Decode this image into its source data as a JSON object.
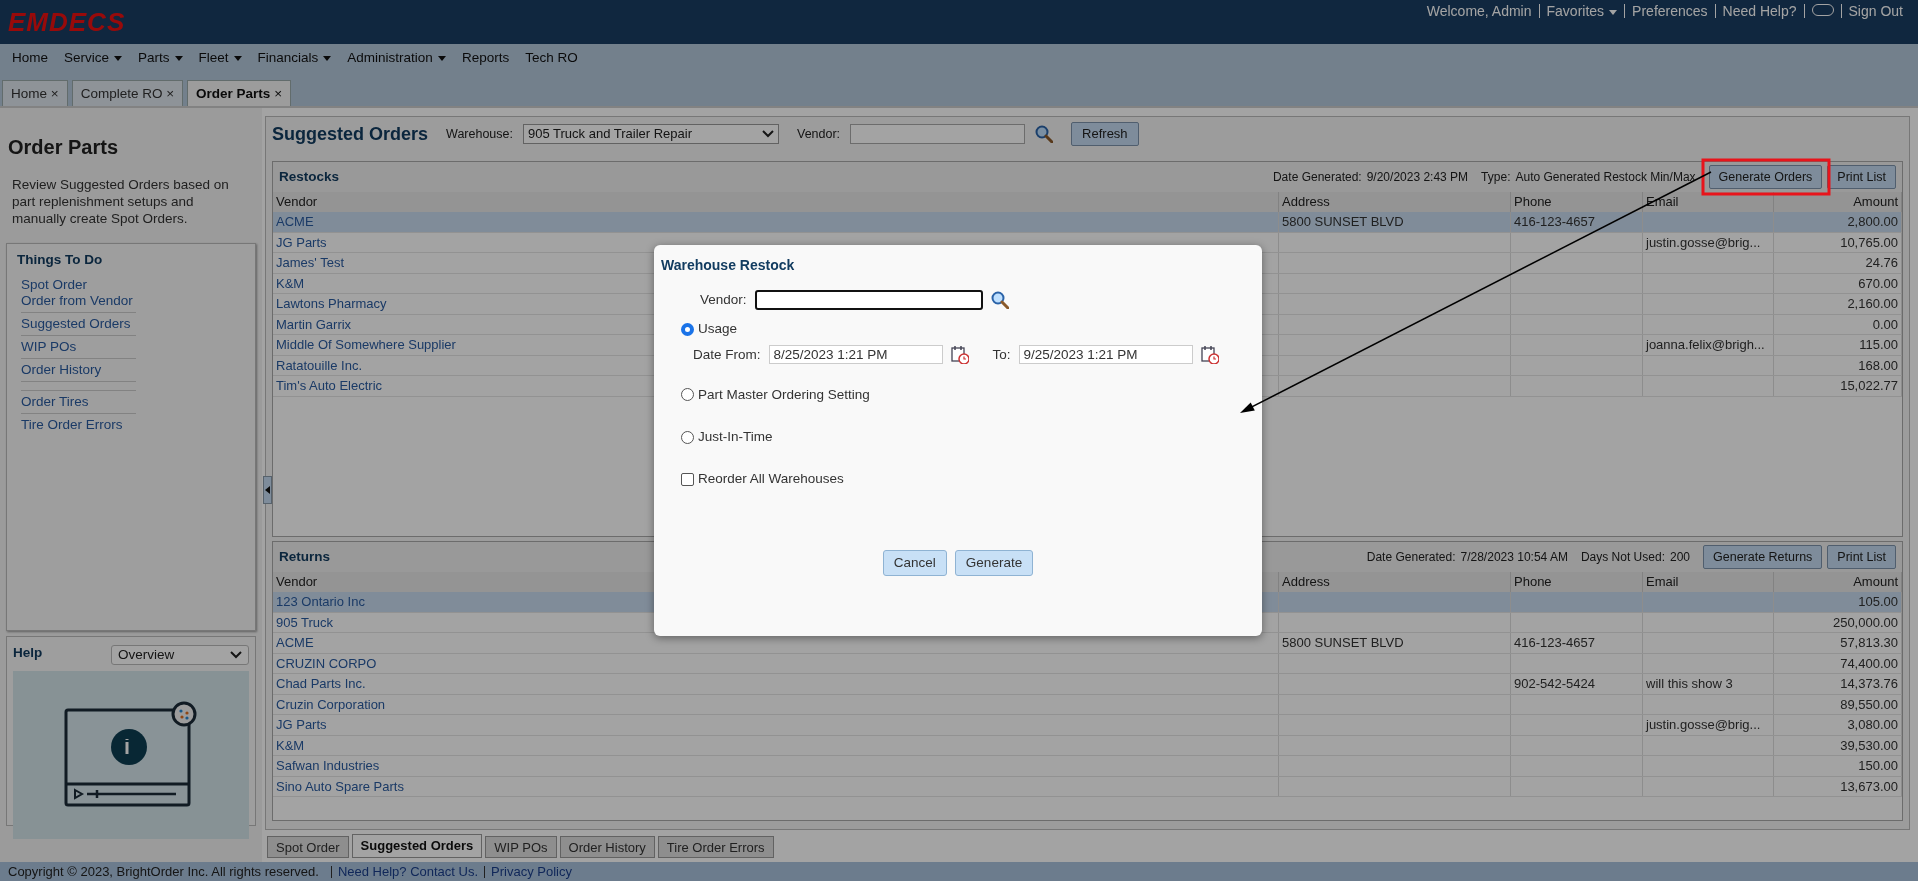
{
  "top_bar": {
    "logo": "EMDECS",
    "links": [
      {
        "label": "Welcome, Admin",
        "kind": "text"
      },
      {
        "label": "Favorites",
        "kind": "dropdown"
      },
      {
        "label": "Preferences",
        "kind": "link"
      },
      {
        "label": "Need Help?",
        "kind": "link"
      },
      {
        "kind": "toggle"
      },
      {
        "label": "Sign Out",
        "kind": "link"
      }
    ]
  },
  "menu": [
    {
      "label": "Home",
      "dropdown": false
    },
    {
      "label": "Service",
      "dropdown": true
    },
    {
      "label": "Parts",
      "dropdown": true
    },
    {
      "label": "Fleet",
      "dropdown": true
    },
    {
      "label": "Financials",
      "dropdown": true
    },
    {
      "label": "Administration",
      "dropdown": true
    },
    {
      "label": "Reports",
      "dropdown": false
    },
    {
      "label": "Tech RO",
      "dropdown": false
    }
  ],
  "tabs": [
    {
      "label": "Home",
      "close": "×",
      "selected": false
    },
    {
      "label": "Complete RO",
      "close": "×",
      "selected": false
    },
    {
      "label": "Order Parts",
      "close": "×",
      "selected": true
    }
  ],
  "sidebar": {
    "title": "Order Parts",
    "description": "Review Suggested Orders based on part replenishment setups and manually create Spot Orders.",
    "things_to_do": {
      "title": "Things To Do",
      "groups": [
        {
          "links": [
            "Spot Order",
            "Order from Vendor"
          ],
          "divider_above": false
        },
        {
          "links": [
            "Suggested Orders"
          ],
          "divider_above": false
        },
        {
          "links": [
            "WIP POs"
          ],
          "divider_above": false
        },
        {
          "links": [
            "Order History"
          ],
          "divider_above": false
        },
        {
          "links": [
            "Order Tires"
          ],
          "divider_above": true
        },
        {
          "links": [
            "Tire Order Errors"
          ],
          "divider_above": false
        }
      ]
    },
    "help": {
      "title": "Help",
      "select": "Overview"
    }
  },
  "header": {
    "title": "Suggested Orders",
    "warehouse_label": "Warehouse:",
    "warehouse": "905 Truck and Trailer Repair",
    "vendor_label": "Vendor:",
    "refresh": "Refresh"
  },
  "restocks": {
    "title": "Restocks",
    "date_label": "Date Generated:",
    "date": "9/20/2023 2:43 PM",
    "type_label": "Type:",
    "type": "Auto Generated Restock Min/Max",
    "buttons": [
      "Generate Orders",
      "Print List"
    ],
    "columns": [
      "Vendor",
      "Address",
      "Phone",
      "Email",
      "Amount"
    ],
    "rows": [
      {
        "selected": true,
        "cells": [
          "ACME",
          "5800 SUNSET BLVD",
          "416-123-4657",
          "",
          "2,800.00"
        ]
      },
      {
        "selected": false,
        "cells": [
          "JG Parts",
          "",
          "",
          "justin.gosse@brig...",
          "10,765.00"
        ]
      },
      {
        "selected": false,
        "cells": [
          "James' Test",
          "",
          "",
          "",
          "24.76"
        ]
      },
      {
        "selected": false,
        "cells": [
          "K&M",
          "",
          "",
          "",
          "670.00"
        ]
      },
      {
        "selected": false,
        "cells": [
          "Lawtons Pharmacy",
          "",
          "",
          "",
          "2,160.00"
        ]
      },
      {
        "selected": false,
        "cells": [
          "Martin Garrix",
          "",
          "",
          "",
          "0.00"
        ]
      },
      {
        "selected": false,
        "cells": [
          "Middle Of Somewhere Supplier",
          "",
          "",
          "joanna.felix@brigh...",
          "115.00"
        ]
      },
      {
        "selected": false,
        "cells": [
          "Ratatouille Inc.",
          "",
          "",
          "",
          "168.00"
        ]
      },
      {
        "selected": false,
        "cells": [
          "Tim's Auto Electric",
          "",
          "",
          "",
          "15,022.77"
        ]
      }
    ]
  },
  "returns": {
    "title": "Returns",
    "date_label": "Date Generated:",
    "date": "7/28/2023 10:54 AM",
    "days_label": "Days Not Used:",
    "days": "200",
    "buttons": [
      "Generate Returns",
      "Print List"
    ],
    "columns": [
      "Vendor",
      "Address",
      "Phone",
      "Email",
      "Amount"
    ],
    "rows": [
      {
        "selected": true,
        "cells": [
          "123 Ontario Inc",
          "",
          "",
          "",
          "105.00"
        ]
      },
      {
        "selected": false,
        "cells": [
          "905 Truck",
          "",
          "",
          "",
          "250,000.00"
        ]
      },
      {
        "selected": false,
        "cells": [
          "ACME",
          "5800 SUNSET BLVD",
          "416-123-4657",
          "",
          "57,813.30"
        ]
      },
      {
        "selected": false,
        "cells": [
          "CRUZIN CORPO",
          "",
          "",
          "",
          "74,400.00"
        ]
      },
      {
        "selected": false,
        "cells": [
          "Chad Parts Inc.",
          "",
          "902-542-5424",
          "will this show 3",
          "14,373.76"
        ]
      },
      {
        "selected": false,
        "cells": [
          "Cruzin Corporation",
          "",
          "",
          "",
          "89,550.00"
        ]
      },
      {
        "selected": false,
        "cells": [
          "JG Parts",
          "",
          "",
          "justin.gosse@brig...",
          "3,080.00"
        ]
      },
      {
        "selected": false,
        "cells": [
          "K&M",
          "",
          "",
          "",
          "39,530.00"
        ]
      },
      {
        "selected": false,
        "cells": [
          "Safwan Industries",
          "",
          "",
          "",
          "150.00"
        ]
      },
      {
        "selected": false,
        "cells": [
          "Sino Auto Spare Parts",
          "",
          "",
          "",
          "13,673.00"
        ]
      }
    ]
  },
  "bottom_tabs": [
    {
      "label": "Spot Order",
      "selected": false
    },
    {
      "label": "Suggested Orders",
      "selected": true
    },
    {
      "label": "WIP POs",
      "selected": false
    },
    {
      "label": "Order History",
      "selected": false
    },
    {
      "label": "Tire Order Errors",
      "selected": false
    }
  ],
  "footer": [
    {
      "label": "Copyright © 2023, BrightOrder Inc. All rights reserved.",
      "kind": "text"
    },
    {
      "label": "Need Help? Contact Us.",
      "kind": "link"
    },
    {
      "label": "Privacy Policy",
      "kind": "link"
    }
  ],
  "dialog": {
    "title": "Warehouse Restock",
    "vendor_label": "Vendor:",
    "options": [
      {
        "kind": "radio",
        "label": "Usage",
        "selected": true,
        "date_from_label": "Date From:",
        "date_from": "8/25/2023 1:21 PM",
        "to_label": "To:",
        "to": "9/25/2023 1:21 PM"
      },
      {
        "kind": "radio",
        "label": "Part Master Ordering Setting",
        "selected": false
      },
      {
        "kind": "radio",
        "label": "Just-In-Time",
        "selected": false
      },
      {
        "kind": "checkbox",
        "label": "Reorder All Warehouses",
        "checked": false
      }
    ],
    "buttons": [
      "Cancel",
      "Generate"
    ]
  }
}
